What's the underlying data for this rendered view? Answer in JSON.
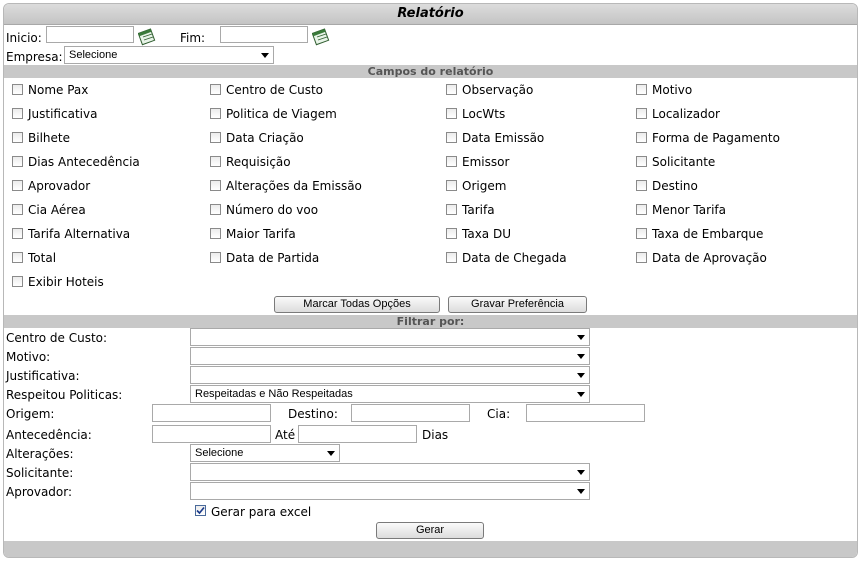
{
  "title": "Relatório",
  "period": {
    "start_label": "Inicio:",
    "start_value": "",
    "end_label": "Fim:",
    "end_value": ""
  },
  "empresa": {
    "label": "Empresa:",
    "selected": "Selecione"
  },
  "campos_header": "Campos do relatório",
  "fields": [
    [
      "Nome Pax",
      "Centro de Custo",
      "Observação",
      "Motivo"
    ],
    [
      "Justificativa",
      "Politica de Viagem",
      "LocWts",
      "Localizador"
    ],
    [
      "Bilhete",
      "Data Criação",
      "Data Emissão",
      "Forma de Pagamento"
    ],
    [
      "Dias Antecedência",
      "Requisição",
      "Emissor",
      "Solicitante"
    ],
    [
      "Aprovador",
      "Alterações da Emissão",
      "Origem",
      "Destino"
    ],
    [
      "Cia Aérea",
      "Número do voo",
      "Tarifa",
      "Menor Tarifa"
    ],
    [
      "Tarifa Alternativa",
      "Maior Tarifa",
      "Taxa DU",
      "Taxa de Embarque"
    ],
    [
      "Total",
      "Data de Partida",
      "Data de Chegada",
      "Data de Aprovação"
    ],
    [
      "Exibir Hoteis"
    ]
  ],
  "buttons": {
    "mark_all": "Marcar Todas Opções",
    "save_pref": "Gravar Preferência",
    "generate": "Gerar"
  },
  "filter_header": "Filtrar por:",
  "filters": {
    "centro_custo": {
      "label": "Centro de Custo:",
      "selected": ""
    },
    "motivo": {
      "label": "Motivo:",
      "selected": ""
    },
    "justificativa": {
      "label": "Justificativa:",
      "selected": ""
    },
    "respeitou": {
      "label": "Respeitou Politicas:",
      "selected": "Respeitadas e Não Respeitadas"
    },
    "origem": {
      "label": "Origem:",
      "value": ""
    },
    "destino": {
      "label": "Destino:",
      "value": ""
    },
    "cia": {
      "label": "Cia:",
      "value": ""
    },
    "antecedencia": {
      "label": "Antecedência:",
      "from": "",
      "ate": "Até",
      "to": "",
      "unit": "Dias"
    },
    "alteracoes": {
      "label": "Alterações:",
      "selected": "Selecione"
    },
    "solicitante": {
      "label": "Solicitante:",
      "selected": ""
    },
    "aprovador": {
      "label": "Aprovador:",
      "selected": ""
    }
  },
  "excel": {
    "label": "Gerar para excel",
    "checked": true
  },
  "icons": {
    "calendar": "calendar-icon",
    "dropdown": "chevron-down-icon",
    "check": "checkmark-icon"
  }
}
